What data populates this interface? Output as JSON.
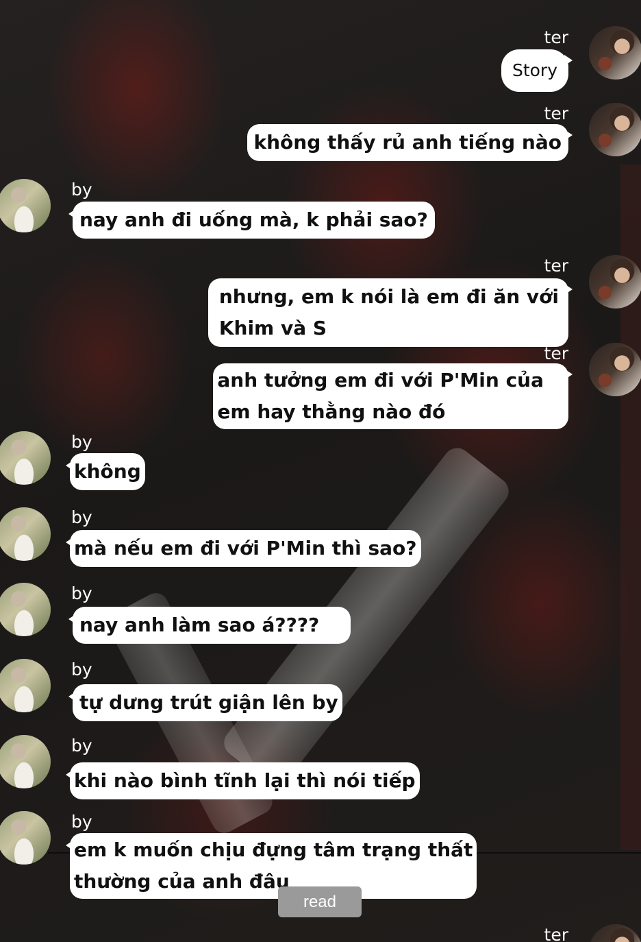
{
  "messages": [
    {
      "sender": "ter",
      "text": "Story"
    },
    {
      "sender": "ter",
      "text": "không thấy rủ anh tiếng nào"
    },
    {
      "sender": "by",
      "text": "nay anh đi uống mà, k phải sao?"
    },
    {
      "sender": "ter",
      "text_lines": [
        "nhưng, em k nói là em đi ăn với",
        "Khim và S"
      ]
    },
    {
      "sender": "ter",
      "text_lines": [
        "anh tưởng em đi với P'Min của",
        "em hay thằng nào đó"
      ]
    },
    {
      "sender": "by",
      "text": "không"
    },
    {
      "sender": "by",
      "text": "mà nếu em đi với P'Min thì sao?"
    },
    {
      "sender": "by",
      "text": "nay anh làm sao á????"
    },
    {
      "sender": "by",
      "text": "tự dưng trút giận lên by"
    },
    {
      "sender": "by",
      "text": "khi nào bình tĩnh lại thì nói tiếp"
    },
    {
      "sender": "by",
      "text_lines": [
        "em k muốn chịu đựng tâm trạng thất",
        "thường của anh đâu"
      ]
    },
    {
      "sender": "ter",
      "text": ""
    }
  ],
  "read_status": "read",
  "colors": {
    "bubble": "#ffffff",
    "read_badge": "#9a9a9a"
  }
}
